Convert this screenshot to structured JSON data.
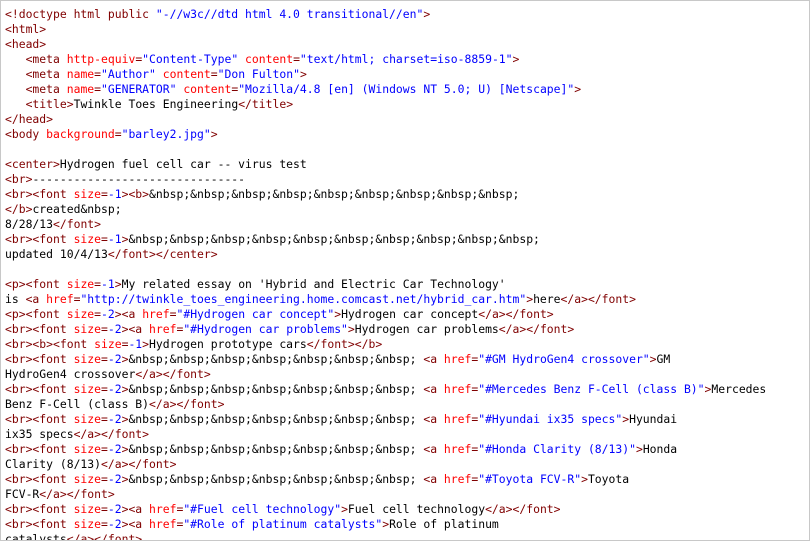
{
  "colors": {
    "tag": "#800000",
    "attribute": "#ff0000",
    "value": "#0000ff",
    "text": "#000000",
    "background": "#ffffff"
  },
  "lines": [
    [
      {
        "t": "tag",
        "s": "<!doctype html public "
      },
      {
        "t": "val",
        "s": "\"-//w3c//dtd html 4.0 transitional//en\""
      },
      {
        "t": "tag",
        "s": ">"
      }
    ],
    [
      {
        "t": "tag",
        "s": "<html>"
      }
    ],
    [
      {
        "t": "tag",
        "s": "<head>"
      }
    ],
    [
      {
        "t": "text",
        "s": "   "
      },
      {
        "t": "tag",
        "s": "<meta "
      },
      {
        "t": "attr",
        "s": "http-equiv"
      },
      {
        "t": "tag",
        "s": "="
      },
      {
        "t": "val",
        "s": "\"Content-Type\""
      },
      {
        "t": "tag",
        "s": " "
      },
      {
        "t": "attr",
        "s": "content"
      },
      {
        "t": "tag",
        "s": "="
      },
      {
        "t": "val",
        "s": "\"text/html; charset=iso-8859-1\""
      },
      {
        "t": "tag",
        "s": ">"
      }
    ],
    [
      {
        "t": "text",
        "s": "   "
      },
      {
        "t": "tag",
        "s": "<meta "
      },
      {
        "t": "attr",
        "s": "name"
      },
      {
        "t": "tag",
        "s": "="
      },
      {
        "t": "val",
        "s": "\"Author\""
      },
      {
        "t": "tag",
        "s": " "
      },
      {
        "t": "attr",
        "s": "content"
      },
      {
        "t": "tag",
        "s": "="
      },
      {
        "t": "val",
        "s": "\"Don Fulton\""
      },
      {
        "t": "tag",
        "s": ">"
      }
    ],
    [
      {
        "t": "text",
        "s": "   "
      },
      {
        "t": "tag",
        "s": "<meta "
      },
      {
        "t": "attr",
        "s": "name"
      },
      {
        "t": "tag",
        "s": "="
      },
      {
        "t": "val",
        "s": "\"GENERATOR\""
      },
      {
        "t": "tag",
        "s": " "
      },
      {
        "t": "attr",
        "s": "content"
      },
      {
        "t": "tag",
        "s": "="
      },
      {
        "t": "val",
        "s": "\"Mozilla/4.8 [en] (Windows NT 5.0; U) [Netscape]\""
      },
      {
        "t": "tag",
        "s": ">"
      }
    ],
    [
      {
        "t": "text",
        "s": "   "
      },
      {
        "t": "tag",
        "s": "<title>"
      },
      {
        "t": "text",
        "s": "Twinkle Toes Engineering"
      },
      {
        "t": "tag",
        "s": "</title>"
      }
    ],
    [
      {
        "t": "tag",
        "s": "</head>"
      }
    ],
    [
      {
        "t": "tag",
        "s": "<body "
      },
      {
        "t": "attr",
        "s": "background"
      },
      {
        "t": "tag",
        "s": "="
      },
      {
        "t": "val",
        "s": "\"barley2.jpg\""
      },
      {
        "t": "tag",
        "s": ">"
      }
    ],
    [],
    [
      {
        "t": "tag",
        "s": "<center>"
      },
      {
        "t": "text",
        "s": "Hydrogen fuel cell car -- virus test"
      }
    ],
    [
      {
        "t": "tag",
        "s": "<br>"
      },
      {
        "t": "text",
        "s": "-------------------------------"
      }
    ],
    [
      {
        "t": "tag",
        "s": "<br><font "
      },
      {
        "t": "attr",
        "s": "size"
      },
      {
        "t": "tag",
        "s": "="
      },
      {
        "t": "val",
        "s": "-1"
      },
      {
        "t": "tag",
        "s": "><b>"
      },
      {
        "t": "text",
        "s": "&nbsp;&nbsp;&nbsp;&nbsp;&nbsp;&nbsp;&nbsp;&nbsp;&nbsp;"
      }
    ],
    [
      {
        "t": "tag",
        "s": "</b>"
      },
      {
        "t": "text",
        "s": "created&nbsp;"
      }
    ],
    [
      {
        "t": "text",
        "s": "8/28/13"
      },
      {
        "t": "tag",
        "s": "</font>"
      }
    ],
    [
      {
        "t": "tag",
        "s": "<br><font "
      },
      {
        "t": "attr",
        "s": "size"
      },
      {
        "t": "tag",
        "s": "="
      },
      {
        "t": "val",
        "s": "-1"
      },
      {
        "t": "tag",
        "s": ">"
      },
      {
        "t": "text",
        "s": "&nbsp;&nbsp;&nbsp;&nbsp;&nbsp;&nbsp;&nbsp;&nbsp;&nbsp;&nbsp;"
      }
    ],
    [
      {
        "t": "text",
        "s": "updated 10/4/13"
      },
      {
        "t": "tag",
        "s": "</font></center>"
      }
    ],
    [],
    [
      {
        "t": "tag",
        "s": "<p><font "
      },
      {
        "t": "attr",
        "s": "size"
      },
      {
        "t": "tag",
        "s": "="
      },
      {
        "t": "val",
        "s": "-1"
      },
      {
        "t": "tag",
        "s": ">"
      },
      {
        "t": "text",
        "s": "My related essay on 'Hybrid and Electric Car Technology'"
      }
    ],
    [
      {
        "t": "text",
        "s": "is "
      },
      {
        "t": "tag",
        "s": "<a "
      },
      {
        "t": "attr",
        "s": "href"
      },
      {
        "t": "tag",
        "s": "="
      },
      {
        "t": "val",
        "s": "\"http://twinkle_toes_engineering.home.comcast.net/hybrid_car.htm\""
      },
      {
        "t": "tag",
        "s": ">"
      },
      {
        "t": "text",
        "s": "here"
      },
      {
        "t": "tag",
        "s": "</a></font>"
      }
    ],
    [
      {
        "t": "tag",
        "s": "<p><font "
      },
      {
        "t": "attr",
        "s": "size"
      },
      {
        "t": "tag",
        "s": "="
      },
      {
        "t": "val",
        "s": "-2"
      },
      {
        "t": "tag",
        "s": "><a "
      },
      {
        "t": "attr",
        "s": "href"
      },
      {
        "t": "tag",
        "s": "="
      },
      {
        "t": "val",
        "s": "\"#Hydrogen car concept\""
      },
      {
        "t": "tag",
        "s": ">"
      },
      {
        "t": "text",
        "s": "Hydrogen car concept"
      },
      {
        "t": "tag",
        "s": "</a></font>"
      }
    ],
    [
      {
        "t": "tag",
        "s": "<br><font "
      },
      {
        "t": "attr",
        "s": "size"
      },
      {
        "t": "tag",
        "s": "="
      },
      {
        "t": "val",
        "s": "-2"
      },
      {
        "t": "tag",
        "s": "><a "
      },
      {
        "t": "attr",
        "s": "href"
      },
      {
        "t": "tag",
        "s": "="
      },
      {
        "t": "val",
        "s": "\"#Hydrogen car problems\""
      },
      {
        "t": "tag",
        "s": ">"
      },
      {
        "t": "text",
        "s": "Hydrogen car problems"
      },
      {
        "t": "tag",
        "s": "</a></font>"
      }
    ],
    [
      {
        "t": "tag",
        "s": "<br><b><font "
      },
      {
        "t": "attr",
        "s": "size"
      },
      {
        "t": "tag",
        "s": "="
      },
      {
        "t": "val",
        "s": "-1"
      },
      {
        "t": "tag",
        "s": ">"
      },
      {
        "t": "text",
        "s": "Hydrogen prototype cars"
      },
      {
        "t": "tag",
        "s": "</font></b>"
      }
    ],
    [
      {
        "t": "tag",
        "s": "<br><font "
      },
      {
        "t": "attr",
        "s": "size"
      },
      {
        "t": "tag",
        "s": "="
      },
      {
        "t": "val",
        "s": "-2"
      },
      {
        "t": "tag",
        "s": ">"
      },
      {
        "t": "text",
        "s": "&nbsp;&nbsp;&nbsp;&nbsp;&nbsp;&nbsp;&nbsp; "
      },
      {
        "t": "tag",
        "s": "<a "
      },
      {
        "t": "attr",
        "s": "href"
      },
      {
        "t": "tag",
        "s": "="
      },
      {
        "t": "val",
        "s": "\"#GM HydroGen4 crossover\""
      },
      {
        "t": "tag",
        "s": ">"
      },
      {
        "t": "text",
        "s": "GM"
      }
    ],
    [
      {
        "t": "text",
        "s": "HydroGen4 crossover"
      },
      {
        "t": "tag",
        "s": "</a></font>"
      }
    ],
    [
      {
        "t": "tag",
        "s": "<br><font "
      },
      {
        "t": "attr",
        "s": "size"
      },
      {
        "t": "tag",
        "s": "="
      },
      {
        "t": "val",
        "s": "-2"
      },
      {
        "t": "tag",
        "s": ">"
      },
      {
        "t": "text",
        "s": "&nbsp;&nbsp;&nbsp;&nbsp;&nbsp;&nbsp;&nbsp; "
      },
      {
        "t": "tag",
        "s": "<a "
      },
      {
        "t": "attr",
        "s": "href"
      },
      {
        "t": "tag",
        "s": "="
      },
      {
        "t": "val",
        "s": "\"#Mercedes Benz F-Cell (class B)\""
      },
      {
        "t": "tag",
        "s": ">"
      },
      {
        "t": "text",
        "s": "Mercedes"
      }
    ],
    [
      {
        "t": "text",
        "s": "Benz F-Cell (class B)"
      },
      {
        "t": "tag",
        "s": "</a></font>"
      }
    ],
    [
      {
        "t": "tag",
        "s": "<br><font "
      },
      {
        "t": "attr",
        "s": "size"
      },
      {
        "t": "tag",
        "s": "="
      },
      {
        "t": "val",
        "s": "-2"
      },
      {
        "t": "tag",
        "s": ">"
      },
      {
        "t": "text",
        "s": "&nbsp;&nbsp;&nbsp;&nbsp;&nbsp;&nbsp;&nbsp; "
      },
      {
        "t": "tag",
        "s": "<a "
      },
      {
        "t": "attr",
        "s": "href"
      },
      {
        "t": "tag",
        "s": "="
      },
      {
        "t": "val",
        "s": "\"#Hyundai ix35 specs\""
      },
      {
        "t": "tag",
        "s": ">"
      },
      {
        "t": "text",
        "s": "Hyundai"
      }
    ],
    [
      {
        "t": "text",
        "s": "ix35 specs"
      },
      {
        "t": "tag",
        "s": "</a></font>"
      }
    ],
    [
      {
        "t": "tag",
        "s": "<br><font "
      },
      {
        "t": "attr",
        "s": "size"
      },
      {
        "t": "tag",
        "s": "="
      },
      {
        "t": "val",
        "s": "-2"
      },
      {
        "t": "tag",
        "s": ">"
      },
      {
        "t": "text",
        "s": "&nbsp;&nbsp;&nbsp;&nbsp;&nbsp;&nbsp;&nbsp; "
      },
      {
        "t": "tag",
        "s": "<a "
      },
      {
        "t": "attr",
        "s": "href"
      },
      {
        "t": "tag",
        "s": "="
      },
      {
        "t": "val",
        "s": "\"#Honda Clarity (8/13)\""
      },
      {
        "t": "tag",
        "s": ">"
      },
      {
        "t": "text",
        "s": "Honda"
      }
    ],
    [
      {
        "t": "text",
        "s": "Clarity (8/13)"
      },
      {
        "t": "tag",
        "s": "</a></font>"
      }
    ],
    [
      {
        "t": "tag",
        "s": "<br><font "
      },
      {
        "t": "attr",
        "s": "size"
      },
      {
        "t": "tag",
        "s": "="
      },
      {
        "t": "val",
        "s": "-2"
      },
      {
        "t": "tag",
        "s": ">"
      },
      {
        "t": "text",
        "s": "&nbsp;&nbsp;&nbsp;&nbsp;&nbsp;&nbsp;&nbsp; "
      },
      {
        "t": "tag",
        "s": "<a "
      },
      {
        "t": "attr",
        "s": "href"
      },
      {
        "t": "tag",
        "s": "="
      },
      {
        "t": "val",
        "s": "\"#Toyota FCV-R\""
      },
      {
        "t": "tag",
        "s": ">"
      },
      {
        "t": "text",
        "s": "Toyota"
      }
    ],
    [
      {
        "t": "text",
        "s": "FCV-R"
      },
      {
        "t": "tag",
        "s": "</a></font>"
      }
    ],
    [
      {
        "t": "tag",
        "s": "<br><font "
      },
      {
        "t": "attr",
        "s": "size"
      },
      {
        "t": "tag",
        "s": "="
      },
      {
        "t": "val",
        "s": "-2"
      },
      {
        "t": "tag",
        "s": "><a "
      },
      {
        "t": "attr",
        "s": "href"
      },
      {
        "t": "tag",
        "s": "="
      },
      {
        "t": "val",
        "s": "\"#Fuel cell technology\""
      },
      {
        "t": "tag",
        "s": ">"
      },
      {
        "t": "text",
        "s": "Fuel cell technology"
      },
      {
        "t": "tag",
        "s": "</a></font>"
      }
    ],
    [
      {
        "t": "tag",
        "s": "<br><font "
      },
      {
        "t": "attr",
        "s": "size"
      },
      {
        "t": "tag",
        "s": "="
      },
      {
        "t": "val",
        "s": "-2"
      },
      {
        "t": "tag",
        "s": "><a "
      },
      {
        "t": "attr",
        "s": "href"
      },
      {
        "t": "tag",
        "s": "="
      },
      {
        "t": "val",
        "s": "\"#Role of platinum catalysts\""
      },
      {
        "t": "tag",
        "s": ">"
      },
      {
        "t": "text",
        "s": "Role of platinum"
      }
    ],
    [
      {
        "t": "text",
        "s": "catalysts"
      },
      {
        "t": "tag",
        "s": "</a></font>"
      }
    ]
  ]
}
